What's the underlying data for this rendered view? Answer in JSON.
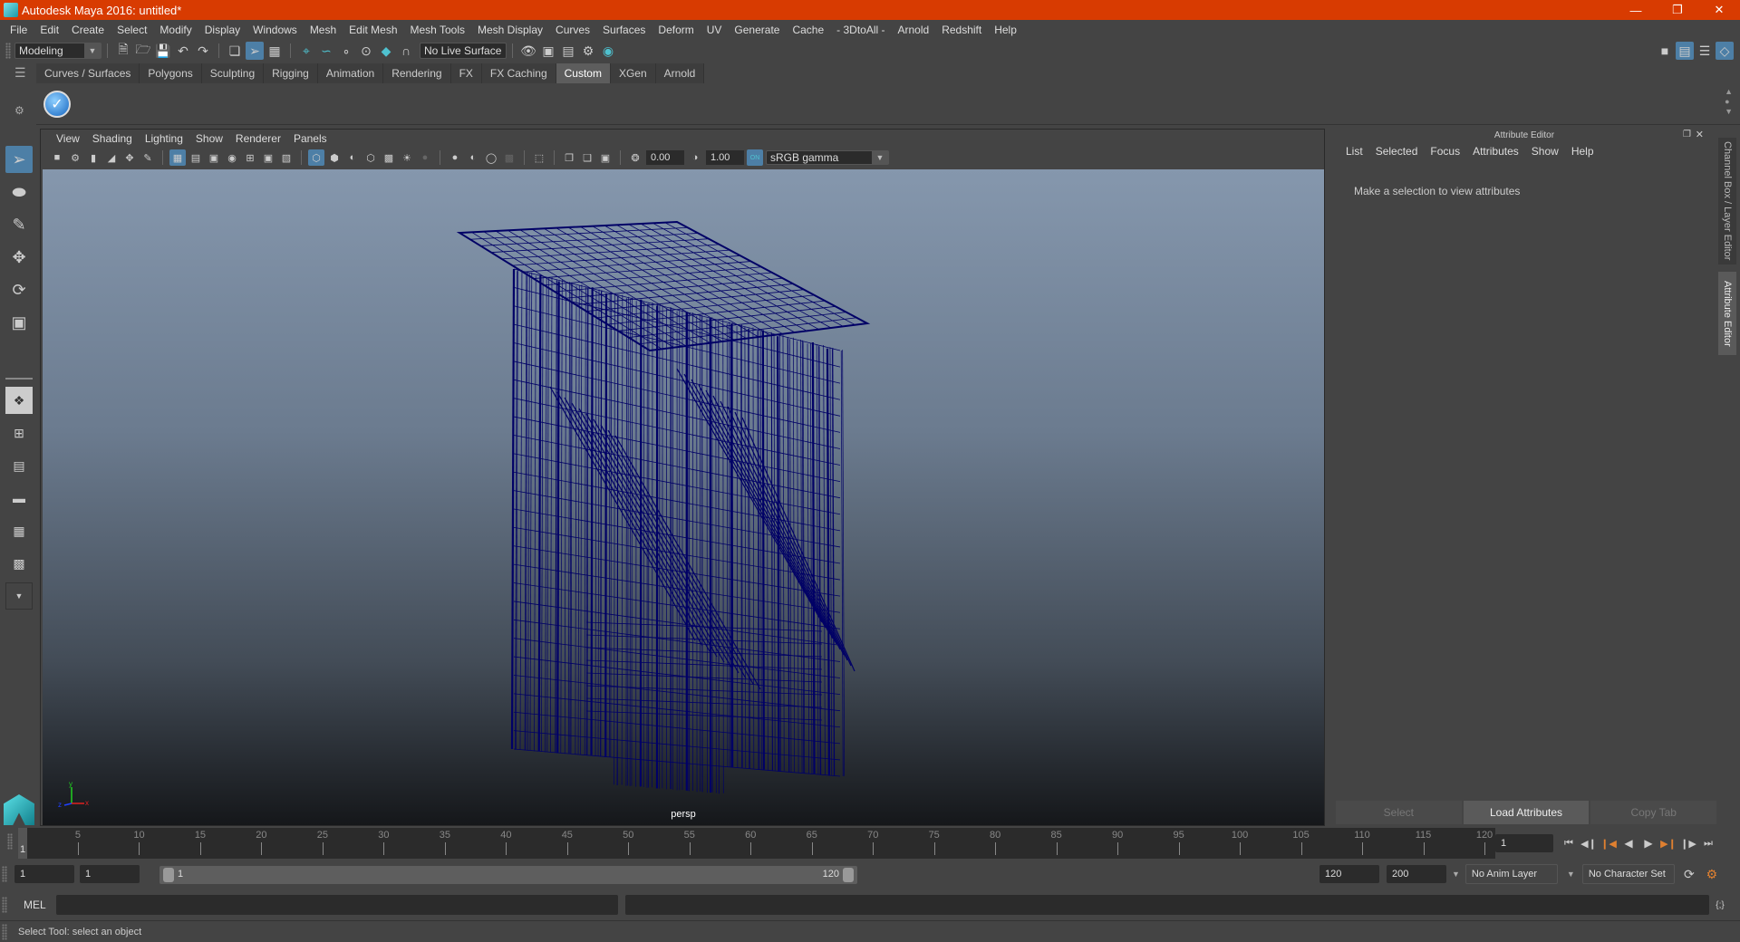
{
  "window": {
    "title": "Autodesk Maya 2016: untitled*",
    "controls": [
      "minimize",
      "restore",
      "close"
    ]
  },
  "menubar": [
    "File",
    "Edit",
    "Create",
    "Select",
    "Modify",
    "Display",
    "Windows",
    "Mesh",
    "Edit Mesh",
    "Mesh Tools",
    "Mesh Display",
    "Curves",
    "Surfaces",
    "Deform",
    "UV",
    "Generate",
    "Cache",
    "- 3DtoAll -",
    "Arnold",
    "Redshift",
    "Help"
  ],
  "statusline": {
    "menuset": "Modeling",
    "live_surface": "No Live Surface"
  },
  "shelf": {
    "tabs": [
      "Curves / Surfaces",
      "Polygons",
      "Sculpting",
      "Rigging",
      "Animation",
      "Rendering",
      "FX",
      "FX Caching",
      "Custom",
      "XGen",
      "Arnold"
    ],
    "active_tab": "Custom"
  },
  "viewport": {
    "menu": [
      "View",
      "Shading",
      "Lighting",
      "Show",
      "Renderer",
      "Panels"
    ],
    "exposure": "0.00",
    "gamma": "1.00",
    "color_management": "ON",
    "view_transform": "sRGB gamma",
    "camera": "persp",
    "axis": {
      "x": "x",
      "y": "y",
      "z": "z"
    },
    "wire_color": "#000066"
  },
  "attribute_editor": {
    "title": "Attribute Editor",
    "menu": [
      "List",
      "Selected",
      "Focus",
      "Attributes",
      "Show",
      "Help"
    ],
    "message": "Make a selection to view attributes",
    "buttons": {
      "select": "Select",
      "load": "Load Attributes",
      "copy": "Copy Tab"
    }
  },
  "side_tabs": {
    "channel_box": "Channel Box / Layer Editor",
    "attribute_editor": "Attribute Editor"
  },
  "timeline": {
    "ticks": [
      "5",
      "10",
      "15",
      "20",
      "25",
      "30",
      "35",
      "40",
      "45",
      "50",
      "55",
      "60",
      "65",
      "70",
      "75",
      "80",
      "85",
      "90",
      "95",
      "100",
      "105",
      "110",
      "115",
      "120"
    ],
    "start": 1,
    "end": 120,
    "current_frame_label": "1",
    "current_frame": "1"
  },
  "range": {
    "start_time": "1",
    "playback_start": "1",
    "slider_start": "1",
    "slider_end": "120",
    "playback_end": "120",
    "end_time": "200",
    "anim_layer": "No Anim Layer",
    "character_set": "No Character Set"
  },
  "cmdline": {
    "label": "MEL",
    "value": ""
  },
  "helpline": "Select Tool: select an object",
  "colors": {
    "titlebar": "#d83b01",
    "accent": "#4d7fa6",
    "teal": "#4fc1cf",
    "key": "#e08030"
  }
}
